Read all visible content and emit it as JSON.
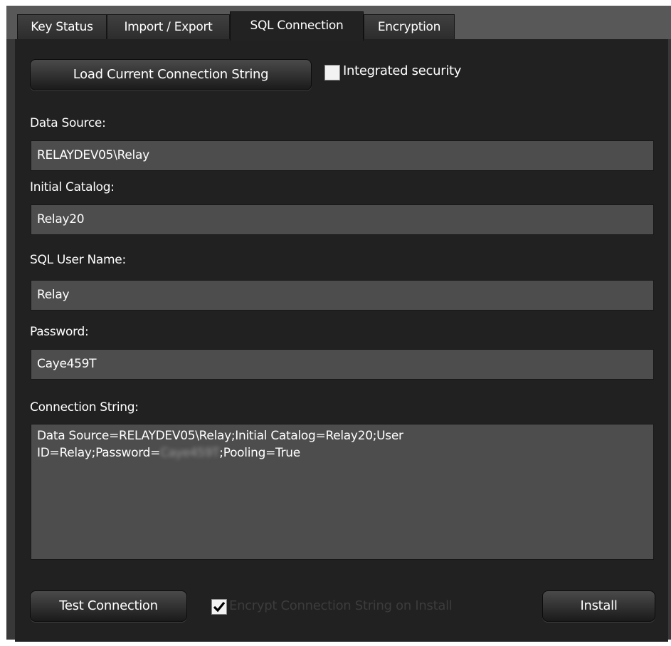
{
  "tabs": [
    {
      "label": "Key Status",
      "active": false
    },
    {
      "label": "Import / Export",
      "active": false
    },
    {
      "label": "SQL Connection",
      "active": true
    },
    {
      "label": "Encryption",
      "active": false
    }
  ],
  "load_button": "Load Current Connection String",
  "integrated_security": {
    "label": "Integrated security",
    "checked": false
  },
  "fields": {
    "data_source": {
      "label": "Data Source:",
      "value": "RELAYDEV05\\Relay"
    },
    "initial_catalog": {
      "label": "Initial Catalog:",
      "value": "Relay20"
    },
    "sql_user_name": {
      "label": "SQL User Name:",
      "value": "Relay"
    },
    "password": {
      "label": "Password:",
      "value": "Caye459T"
    }
  },
  "connection_string": {
    "label": "Connection String:",
    "line1": "Data Source=RELAYDEV05\\Relay;Initial Catalog=Relay20;User",
    "line2_prefix": "ID=Relay;Password=",
    "line2_redacted": "Caye459T",
    "line2_suffix": ";Pooling=True"
  },
  "test_button": "Test Connection",
  "encrypt_on_install": {
    "label": "Encrypt Connection String on Install",
    "checked": true
  },
  "install_button": "Install",
  "colors": {
    "panel_bg": "#212121",
    "field_bg": "#4d4d4d",
    "tabstrip_bg": "#585858",
    "text": "#ffffff",
    "disabled_text": "#3c3c3c"
  },
  "icons": {
    "checkmark": "checkmark-icon"
  }
}
